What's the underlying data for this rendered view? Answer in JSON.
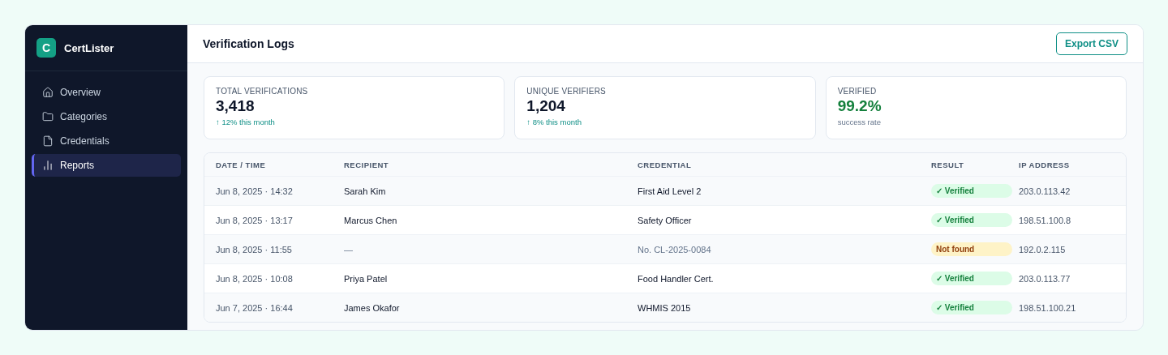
{
  "brand": {
    "initial": "C",
    "name": "CertLister"
  },
  "sidebar": {
    "items": [
      {
        "label": "Overview",
        "kind": "home",
        "selected": false
      },
      {
        "label": "Categories",
        "kind": "folder",
        "selected": false
      },
      {
        "label": "Credentials",
        "kind": "file",
        "selected": false
      },
      {
        "label": "Reports",
        "kind": "chart",
        "selected": true
      }
    ]
  },
  "header": {
    "title": "Verification Logs",
    "export_button": "Export CSV"
  },
  "stats": [
    {
      "kind": "trend",
      "label": "TOTAL VERIFICATIONS",
      "value": "3,418",
      "note": "↑ 12% this month"
    },
    {
      "kind": "trend",
      "label": "UNIQUE VERIFIERS",
      "value": "1,204",
      "note": "↑ 8% this month"
    },
    {
      "kind": "rate",
      "label": "VERIFIED",
      "value": "99.2%",
      "note": "success rate"
    }
  ],
  "table": {
    "columns": [
      "DATE / TIME",
      "RECIPIENT",
      "CREDENTIAL",
      "RESULT",
      "IP ADDRESS"
    ],
    "rows": [
      {
        "datetime": "Jun 8, 2025 · 14:32",
        "recipient": "Sarah Kim",
        "credential": "First Aid Level 2",
        "result": {
          "kind": "verified",
          "label": "✓ Verified"
        },
        "ip": "203.0.113.42"
      },
      {
        "datetime": "Jun 8, 2025 · 13:17",
        "recipient": "Marcus Chen",
        "credential": "Safety Officer",
        "result": {
          "kind": "verified",
          "label": "✓ Verified"
        },
        "ip": "198.51.100.8"
      },
      {
        "datetime": "Jun 8, 2025 · 11:55",
        "recipient": "—",
        "credential": "No. CL-2025-0084",
        "result": {
          "kind": "not_found",
          "label": "Not found"
        },
        "ip": "192.0.2.115"
      },
      {
        "datetime": "Jun 8, 2025 · 10:08",
        "recipient": "Priya Patel",
        "credential": "Food Handler Cert.",
        "result": {
          "kind": "verified",
          "label": "✓ Verified"
        },
        "ip": "203.0.113.77"
      },
      {
        "datetime": "Jun 7, 2025 · 16:44",
        "recipient": "James Okafor",
        "credential": "WHMIS 2015",
        "result": {
          "kind": "verified",
          "label": "✓ Verified"
        },
        "ip": "198.51.100.21"
      }
    ]
  }
}
